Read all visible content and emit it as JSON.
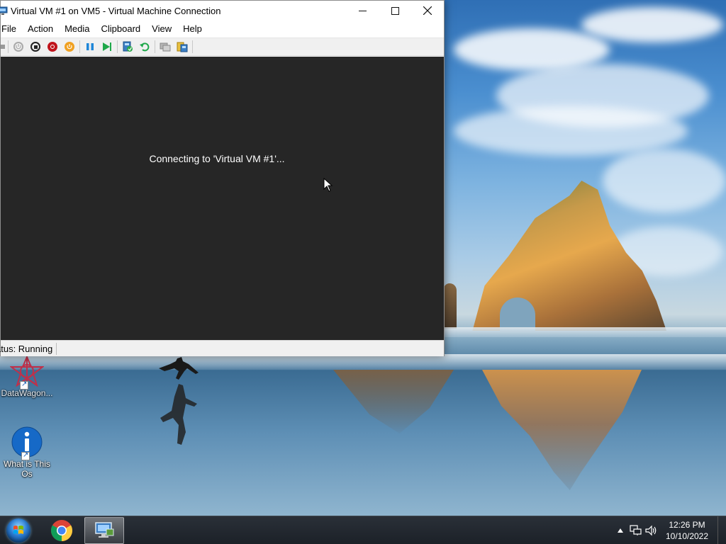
{
  "window": {
    "title": "Virtual VM #1 on VM5 - Virtual Machine Connection",
    "controls": {
      "minimize": "—",
      "maximize": "☐",
      "close": "✕"
    }
  },
  "menu": [
    "File",
    "Action",
    "Media",
    "Clipboard",
    "View",
    "Help"
  ],
  "toolbar": {
    "buttons": [
      "start-icon",
      "turn-off-icon",
      "shut-down-icon",
      "save-icon",
      "pause-icon",
      "resume-icon",
      "checkpoint-icon",
      "revert-icon",
      "enhanced-session-icon",
      "share-icon"
    ]
  },
  "screen": {
    "message": "Connecting to 'Virtual VM #1'..."
  },
  "status": {
    "text": "atus: Running"
  },
  "desktop_icons": [
    {
      "label": "DataWagon...",
      "icon": "datawagon-icon"
    },
    {
      "label": "What is This Os",
      "icon": "info-icon"
    }
  ],
  "taskbar": {
    "apps": [
      "start-orb",
      "chrome-icon",
      "vm-connection-icon"
    ],
    "tray": {
      "time": "12:26 PM",
      "date": "10/10/2022"
    }
  }
}
